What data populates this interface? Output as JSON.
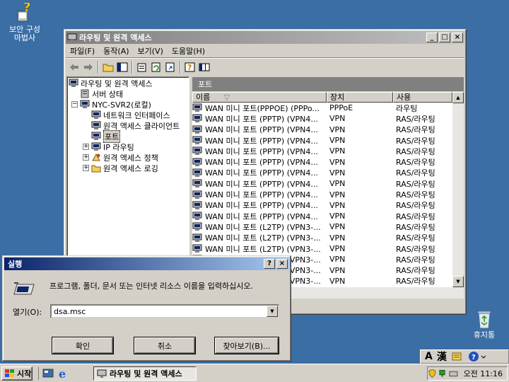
{
  "desktop": {
    "security_icon_label": "보안 구성\n마법사",
    "recycle_bin_label": "휴지통"
  },
  "main_window": {
    "title": "라우팅 및 원격 액세스",
    "menu": [
      "파일(F)",
      "동작(A)",
      "보기(V)",
      "도움말(H)"
    ],
    "tree": {
      "root": "라우팅 및 원격 액세스",
      "server_status": "서버 상태",
      "server": "NYC-SVR2(로컬)",
      "network_interfaces": "네트워크 인터페이스",
      "remote_clients": "원격 액세스 클라이언트",
      "ports": "포트",
      "ip_routing": "IP 라우팅",
      "remote_policy": "원격 액세스 정책",
      "remote_logging": "원격 액세스 로깅"
    },
    "pane_title": "포트",
    "columns": [
      "이름",
      "장치",
      "사용"
    ],
    "rows": [
      {
        "name": "WAN 미니 포트(PPPOE) (PPPo...",
        "device": "PPPoE",
        "usage": "라우팅"
      },
      {
        "name": "WAN 미니 포트 (PPTP) (VPN4...",
        "device": "VPN",
        "usage": "RAS/라우팅"
      },
      {
        "name": "WAN 미니 포트 (PPTP) (VPN4...",
        "device": "VPN",
        "usage": "RAS/라우팅"
      },
      {
        "name": "WAN 미니 포트 (PPTP) (VPN4...",
        "device": "VPN",
        "usage": "RAS/라우팅"
      },
      {
        "name": "WAN 미니 포트 (PPTP) (VPN4...",
        "device": "VPN",
        "usage": "RAS/라우팅"
      },
      {
        "name": "WAN 미니 포트 (PPTP) (VPN4...",
        "device": "VPN",
        "usage": "RAS/라우팅"
      },
      {
        "name": "WAN 미니 포트 (PPTP) (VPN4...",
        "device": "VPN",
        "usage": "RAS/라우팅"
      },
      {
        "name": "WAN 미니 포트 (PPTP) (VPN4...",
        "device": "VPN",
        "usage": "RAS/라우팅"
      },
      {
        "name": "WAN 미니 포트 (PPTP) (VPN4...",
        "device": "VPN",
        "usage": "RAS/라우팅"
      },
      {
        "name": "WAN 미니 포트 (PPTP) (VPN4...",
        "device": "VPN",
        "usage": "RAS/라우팅"
      },
      {
        "name": "WAN 미니 포트 (PPTP) (VPN4...",
        "device": "VPN",
        "usage": "RAS/라우팅"
      },
      {
        "name": "WAN 미니 포트 (L2TP) (VPN3-...",
        "device": "VPN",
        "usage": "RAS/라우팅"
      },
      {
        "name": "WAN 미니 포트 (L2TP) (VPN3-...",
        "device": "VPN",
        "usage": "RAS/라우팅"
      },
      {
        "name": "WAN 미니 포트 (L2TP) (VPN3-...",
        "device": "VPN",
        "usage": "RAS/라우팅"
      },
      {
        "name": "WAN 미니 포트 (L2TP) (VPN3-...",
        "device": "VPN",
        "usage": "RAS/라우팅"
      },
      {
        "name": "WAN 미니 포트 (L2TP) (VPN3-...",
        "device": "VPN",
        "usage": "RAS/라우팅"
      },
      {
        "name": "WAN 미니 포트 (L2TP) (VPN3-...",
        "device": "VPN",
        "usage": "RAS/라우팅"
      }
    ]
  },
  "run_dialog": {
    "title": "실행",
    "description": "프로그램, 폴더, 문서 또는 인터넷 리소스 이름을 입력하십시오.",
    "open_label": "열기(O):",
    "open_value": "dsa.msc",
    "ok": "확인",
    "cancel": "취소",
    "browse": "찾아보기(B)..."
  },
  "taskbar": {
    "start": "시작",
    "task": "라우팅 및 원격 액세스",
    "clock": "오전 11:16"
  },
  "langbar": {
    "mode": "A",
    "hanja": "漢"
  }
}
